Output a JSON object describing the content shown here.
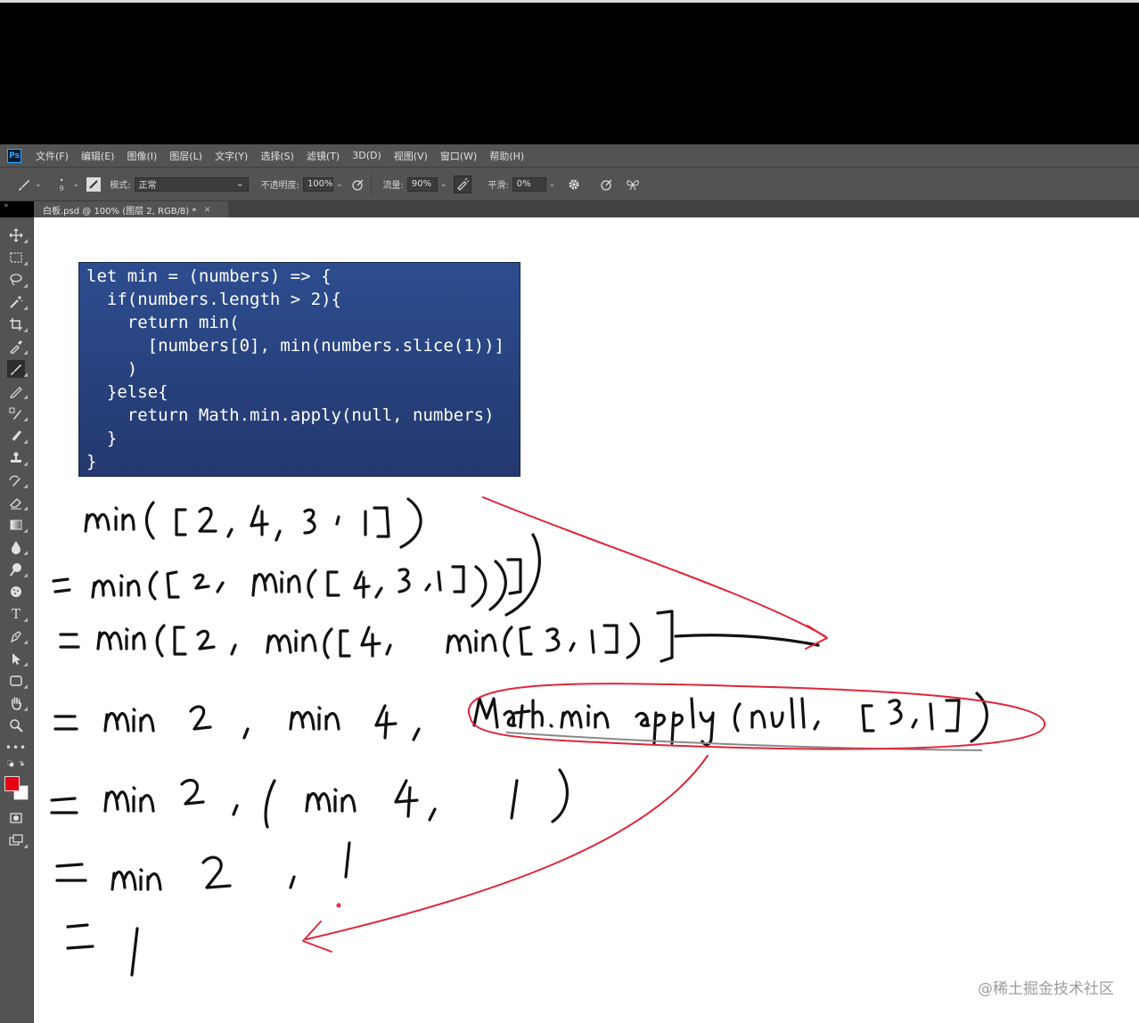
{
  "app": {
    "logo": "Ps"
  },
  "menu": [
    "文件(F)",
    "编辑(E)",
    "图像(I)",
    "图层(L)",
    "文字(Y)",
    "选择(S)",
    "滤镜(T)",
    "3D(D)",
    "视图(V)",
    "窗口(W)",
    "帮助(H)"
  ],
  "options": {
    "brush_size": "9",
    "mode_label": "模式:",
    "mode_value": "正常",
    "opacity_label": "不透明度:",
    "opacity_value": "100%",
    "flow_label": "流量:",
    "flow_value": "90%",
    "smoothing_label": "平滑:",
    "smoothing_value": "0%"
  },
  "document_tab": {
    "title": "白板.psd @ 100% (图层 2, RGB/8) *",
    "close": "×"
  },
  "colors": {
    "foreground": "#e60012",
    "background": "#ffffff"
  },
  "code_lines": [
    "let min = (numbers) => {",
    "  if(numbers.length > 2){",
    "    return min(",
    "      [numbers[0], min(numbers.slice(1))]",
    "    )",
    "  }else{",
    "    return Math.min.apply(null, numbers)",
    "  }",
    "}"
  ],
  "watermark": "@稀土掘金技术社区",
  "tools": [
    "move-icon",
    "marquee-icon",
    "lasso-icon",
    "magic-wand-icon",
    "crop-icon",
    "eyedropper-icon",
    "brush-icon",
    "pencil-icon",
    "color-replacement-icon",
    "mixer-brush-icon",
    "stamp-icon",
    "history-brush-icon",
    "eraser-icon",
    "gradient-icon",
    "blur-icon",
    "dodge-icon",
    "sponge-icon",
    "type-icon",
    "pen-icon",
    "path-select-icon",
    "shape-icon",
    "hand-icon",
    "zoom-icon",
    "more-icon"
  ]
}
